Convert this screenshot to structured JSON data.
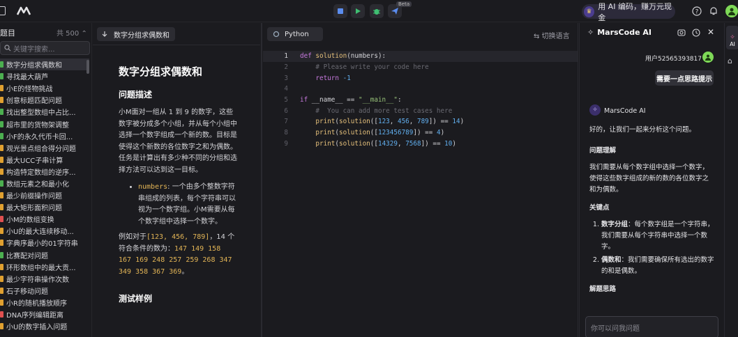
{
  "topbar": {
    "beta_label": "Beta",
    "ai_badge": "用 AI 编码，赚万元现金"
  },
  "problem_list": {
    "title": "题目",
    "count": "共 500",
    "search_placeholder": "关键字搜索...",
    "items": [
      {
        "label": "数字分组求偶数和",
        "color": "#4caf50"
      },
      {
        "label": "寻找最大葫芦",
        "color": "#4caf50"
      },
      {
        "label": "小E的怪物挑战",
        "color": "#e0a030"
      },
      {
        "label": "创意标题匹配问题",
        "color": "#e0a030"
      },
      {
        "label": "找出整型数组中占比...",
        "color": "#4caf50"
      },
      {
        "label": "超市里的货物架调整",
        "color": "#4caf50"
      },
      {
        "label": "小F的永久代币卡回...",
        "color": "#4caf50"
      },
      {
        "label": "观光景点组合得分问题",
        "color": "#e0a030"
      },
      {
        "label": "最大UCC子串计算",
        "color": "#e0a030"
      },
      {
        "label": "构造特定数组的逆序...",
        "color": "#e0a030"
      },
      {
        "label": "数组元素之和最小化",
        "color": "#4caf50"
      },
      {
        "label": "最少前缀操作问题",
        "color": "#e0a030"
      },
      {
        "label": "最大矩形面积问题",
        "color": "#e0a030"
      },
      {
        "label": "小M的数组变换",
        "color": "#e05050"
      },
      {
        "label": "小U的最大连续移动...",
        "color": "#e0a030"
      },
      {
        "label": "字典序最小的01字符串",
        "color": "#e0a030"
      },
      {
        "label": "比赛配对问题",
        "color": "#4caf50"
      },
      {
        "label": "环形数组中的最大贡...",
        "color": "#e0a030"
      },
      {
        "label": "最少字符串操作次数",
        "color": "#e0a030"
      },
      {
        "label": "石子移动问题",
        "color": "#e0a030"
      },
      {
        "label": "小R的随机播放顺序",
        "color": "#e0a030"
      },
      {
        "label": "DNA序列编辑距离",
        "color": "#e05050"
      },
      {
        "label": "小U的数字插入问题",
        "color": "#e0a030"
      }
    ]
  },
  "description": {
    "tab": "数字分组求偶数和",
    "title": "数字分组求偶数和",
    "section1": "问题描述",
    "para1": "小M面对一组从 1 到 9 的数字，这些数字被分成多个小组，并从每个小组中选择一个数字组成一个新的数。目标是使得这个新数的各位数字之和为偶数。任务是计算出有多少种不同的分组和选择方法可以达到这一目标。",
    "bullet_code": "numbers",
    "bullet_text": ": 一个由多个整数字符串组成的列表，每个字符串可以视为一个数字组。小M需要从每个数字组中选择一个数字。",
    "example_prefix": "例如对于",
    "example_code": "[123, 456, 789]",
    "example_mid": "，14 个符合条件的数为：",
    "example_nums": "147 149 158 167 169 248 257 259 268 347 349 358 367 369",
    "example_end": "。",
    "section2": "测试样例"
  },
  "editor": {
    "language": "Python",
    "switch_label": "切换语言",
    "lines": [
      {
        "n": "1",
        "text": "def solution(numbers):"
      },
      {
        "n": "2",
        "text": "    # Please write your code here"
      },
      {
        "n": "3",
        "text": "    return -1"
      },
      {
        "n": "4",
        "text": ""
      },
      {
        "n": "5",
        "text": "if __name__ == \"__main__\":"
      },
      {
        "n": "6",
        "text": "    #  You can add more test cases here"
      },
      {
        "n": "7",
        "text": "    print(solution([123, 456, 789]) == 14)"
      },
      {
        "n": "8",
        "text": "    print(solution([123456789]) == 4)"
      },
      {
        "n": "9",
        "text": "    print(solution([14329, 7568]) == 10)"
      }
    ]
  },
  "ai_panel": {
    "title": "MarsCode AI",
    "user_name": "用户52565393817",
    "user_message": "需要一点思路提示",
    "bot_name": "MarsCode AI",
    "intro": "好的，让我们一起来分析这个问题。",
    "h_understand": "问题理解",
    "understand_text": "我们需要从每个数字组中选择一个数字，使得这些数字组成的新的数的各位数字之和为偶数。",
    "h_key": "关键点",
    "key1_bold": "数字分组",
    "key1_text": "：每个数字组是一个字符串，我们需要从每个字符串中选择一个数字。",
    "key2_bold": "偶数和",
    "key2_text": "：我们需要确保所有选出的数字的和是偶数。",
    "h_approach": "解题思路",
    "input_placeholder": "你可以问我问题"
  },
  "right_strip": {
    "ai_label": "AI"
  }
}
